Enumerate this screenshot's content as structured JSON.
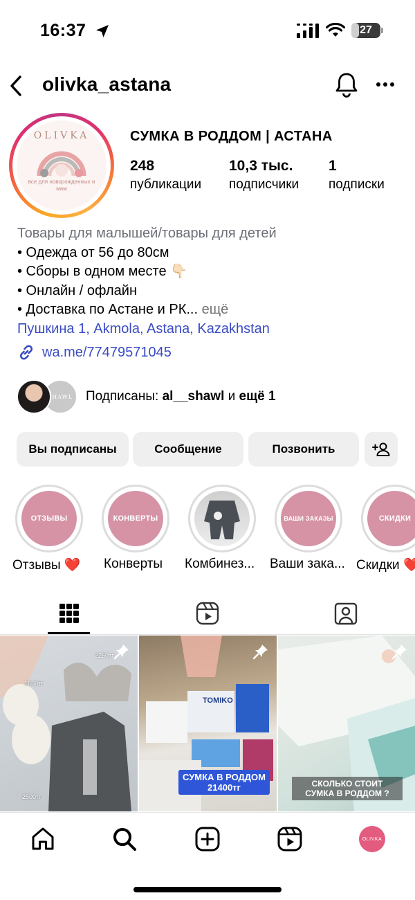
{
  "status_bar": {
    "time": "16:37",
    "battery": "27",
    "battery_fraction": 0.27
  },
  "header": {
    "username": "olivka_astana"
  },
  "avatar": {
    "logo_word": "OLIVKA",
    "logo_sub": "все для новорожденных и мам"
  },
  "profile": {
    "name": "СУМКА В РОДДОМ | АСТАНА",
    "stats": [
      {
        "value": "248",
        "label": "публикации"
      },
      {
        "value": "10,3 тыс.",
        "label": "подписчики"
      },
      {
        "value": "1",
        "label": "подписки"
      }
    ]
  },
  "bio": {
    "category": "Товары для малышей/товары для детей",
    "line1": "• Одежда от 56 до 80см",
    "line2": "• Сборы в одном месте 👇🏻",
    "line3": "• Онлайн / офлайн",
    "line4": "• Доставка по Астане и РК...",
    "more": "ещё",
    "location": "Пушкина 1, Akmola, Astana, Kazakhstan",
    "link": "wa.me/77479571045"
  },
  "followed_by": {
    "prefix": "Подписаны: ",
    "user": "al__shawl",
    "middle": " и ",
    "rest": "ещё 1",
    "second_avatar_text": "SHAWL"
  },
  "buttons": {
    "following": "Вы подписаны",
    "message": "Сообщение",
    "call": "Позвонить"
  },
  "highlights": [
    {
      "cover_text": "ОТЗЫВЫ",
      "label": "Отзывы ❤️"
    },
    {
      "cover_text": "КОНВЕРТЫ",
      "label": "Конверты"
    },
    {
      "cover_text": "",
      "label": "Комбинез..."
    },
    {
      "cover_text": "ВАШИ ЗАКАЗЫ",
      "label": "Ваши зака..."
    },
    {
      "cover_text": "СКИДКИ",
      "label": "Скидки ❤️"
    }
  ],
  "posts": [
    {
      "prices": [
        "2250тг",
        "1650тг",
        "2500тг"
      ]
    },
    {
      "caption_line1": "СУМКА В РОДДОМ",
      "caption_line2": "21400тг",
      "brand": "TOMIKO"
    },
    {
      "caption_line1": "СКОЛЬКО СТОИТ",
      "caption_line2": "СУМКА В РОДДОМ ?"
    }
  ],
  "nav_avatar_text": "OLIVKA",
  "colors": {
    "link_blue": "#3a4bc4",
    "highlight_pink": "#d693a6",
    "button_gray": "#efefef"
  }
}
